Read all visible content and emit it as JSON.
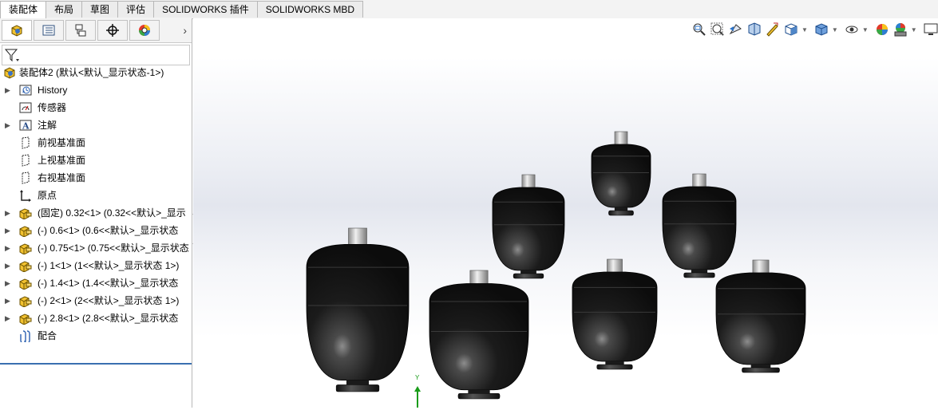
{
  "tabs": [
    {
      "label": "装配体",
      "active": true
    },
    {
      "label": "布局",
      "active": false
    },
    {
      "label": "草图",
      "active": false
    },
    {
      "label": "评估",
      "active": false
    },
    {
      "label": "SOLIDWORKS 插件",
      "active": false
    },
    {
      "label": "SOLIDWORKS MBD",
      "active": false
    }
  ],
  "panel_tabs": [
    "feature-manager-icon",
    "property-manager-icon",
    "configuration-manager-icon",
    "dimxpert-icon",
    "display-manager-icon"
  ],
  "tree": {
    "root": "装配体2  (默认<默认_显示状态-1>)",
    "items": [
      {
        "label": "History",
        "icon": "history-icon",
        "expand": true
      },
      {
        "label": "传感器",
        "icon": "sensor-icon",
        "expand": false
      },
      {
        "label": "注解",
        "icon": "annotation-icon",
        "expand": true
      },
      {
        "label": "前视基准面",
        "icon": "plane-icon",
        "expand": false
      },
      {
        "label": "上视基准面",
        "icon": "plane-icon",
        "expand": false
      },
      {
        "label": "右视基准面",
        "icon": "plane-icon",
        "expand": false
      },
      {
        "label": "原点",
        "icon": "origin-icon",
        "expand": false
      },
      {
        "label": "(固定) 0.32<1> (0.32<<默认>_显示",
        "icon": "part-icon",
        "expand": true
      },
      {
        "label": "(-) 0.6<1> (0.6<<默认>_显示状态",
        "icon": "part-icon",
        "expand": true
      },
      {
        "label": "(-) 0.75<1> (0.75<<默认>_显示状态",
        "icon": "part-icon",
        "expand": true
      },
      {
        "label": "(-) 1<1> (1<<默认>_显示状态 1>)",
        "icon": "part-icon",
        "expand": true
      },
      {
        "label": "(-) 1.4<1> (1.4<<默认>_显示状态",
        "icon": "part-icon",
        "expand": true
      },
      {
        "label": "(-) 2<1> (2<<默认>_显示状态 1>)",
        "icon": "part-icon",
        "expand": true
      },
      {
        "label": "(-) 2.8<1> (2.8<<默认>_显示状态",
        "icon": "part-icon",
        "expand": true
      },
      {
        "label": "配合",
        "icon": "mates-icon",
        "expand": false
      }
    ]
  },
  "hud_icons": [
    "zoom-to-fit-icon",
    "zoom-to-area-icon",
    "previous-view-icon",
    "section-view-icon",
    "dynamic-annotation-icon",
    "view-orientation-icon",
    "display-style-icon",
    "hide-show-items-icon",
    "edit-appearance-icon",
    "apply-scene-icon",
    "view-settings-icon"
  ],
  "triad_label": "Y",
  "colors": {
    "selection_line": "#3a6fb0",
    "tank_body": "#1b1b1b",
    "accent": "#f2c230"
  }
}
